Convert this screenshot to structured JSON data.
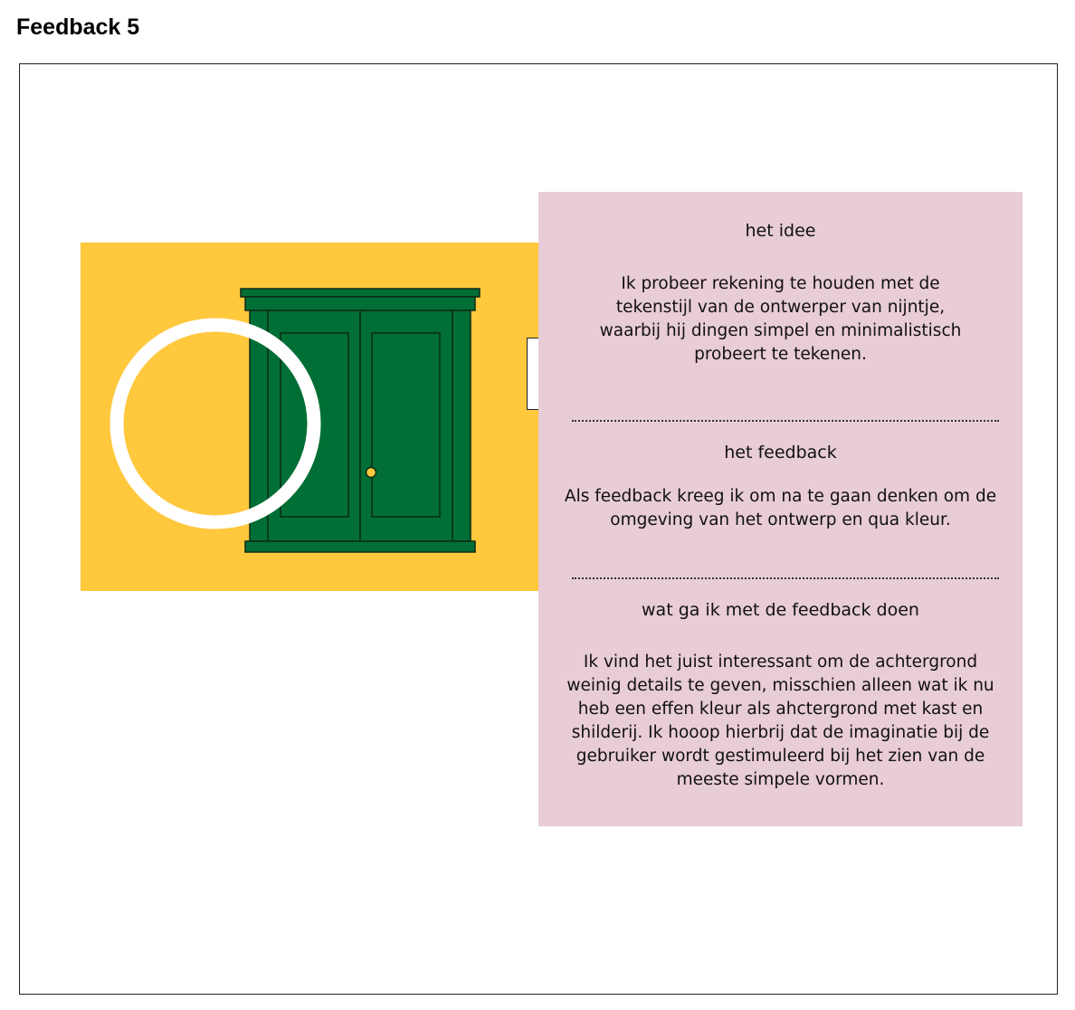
{
  "page": {
    "title": "Feedback 5"
  },
  "colors": {
    "scene_background": "#ffc83d",
    "cabinet_green": "#006f35",
    "ring": "#ffffff",
    "panel_background": "#e8ccd7"
  },
  "illustration": {
    "cabinet_icon": "cabinet-icon",
    "ring_icon": "ring-icon",
    "knob_icon": "knob-icon"
  },
  "panel": {
    "sections": [
      {
        "heading": "het idee",
        "body": "Ik probeer rekening te houden met de tekenstijl van de ontwerper van nijntje, waarbij hij dingen simpel en minimalistisch probeert te tekenen."
      },
      {
        "heading": "het feedback",
        "body": "Als feedback kreeg ik om na te gaan denken om de omgeving van het ontwerp en qua kleur."
      },
      {
        "heading": "wat ga ik met de feedback doen",
        "body": "Ik vind het juist interessant om de achtergrond weinig details te geven, misschien alleen wat ik nu heb een effen kleur als ahctergrond met kast en shilderij. Ik hooop hierbrij dat de imaginatie bij de gebruiker wordt gestimuleerd bij het zien van de meeste simpele vormen."
      }
    ]
  }
}
